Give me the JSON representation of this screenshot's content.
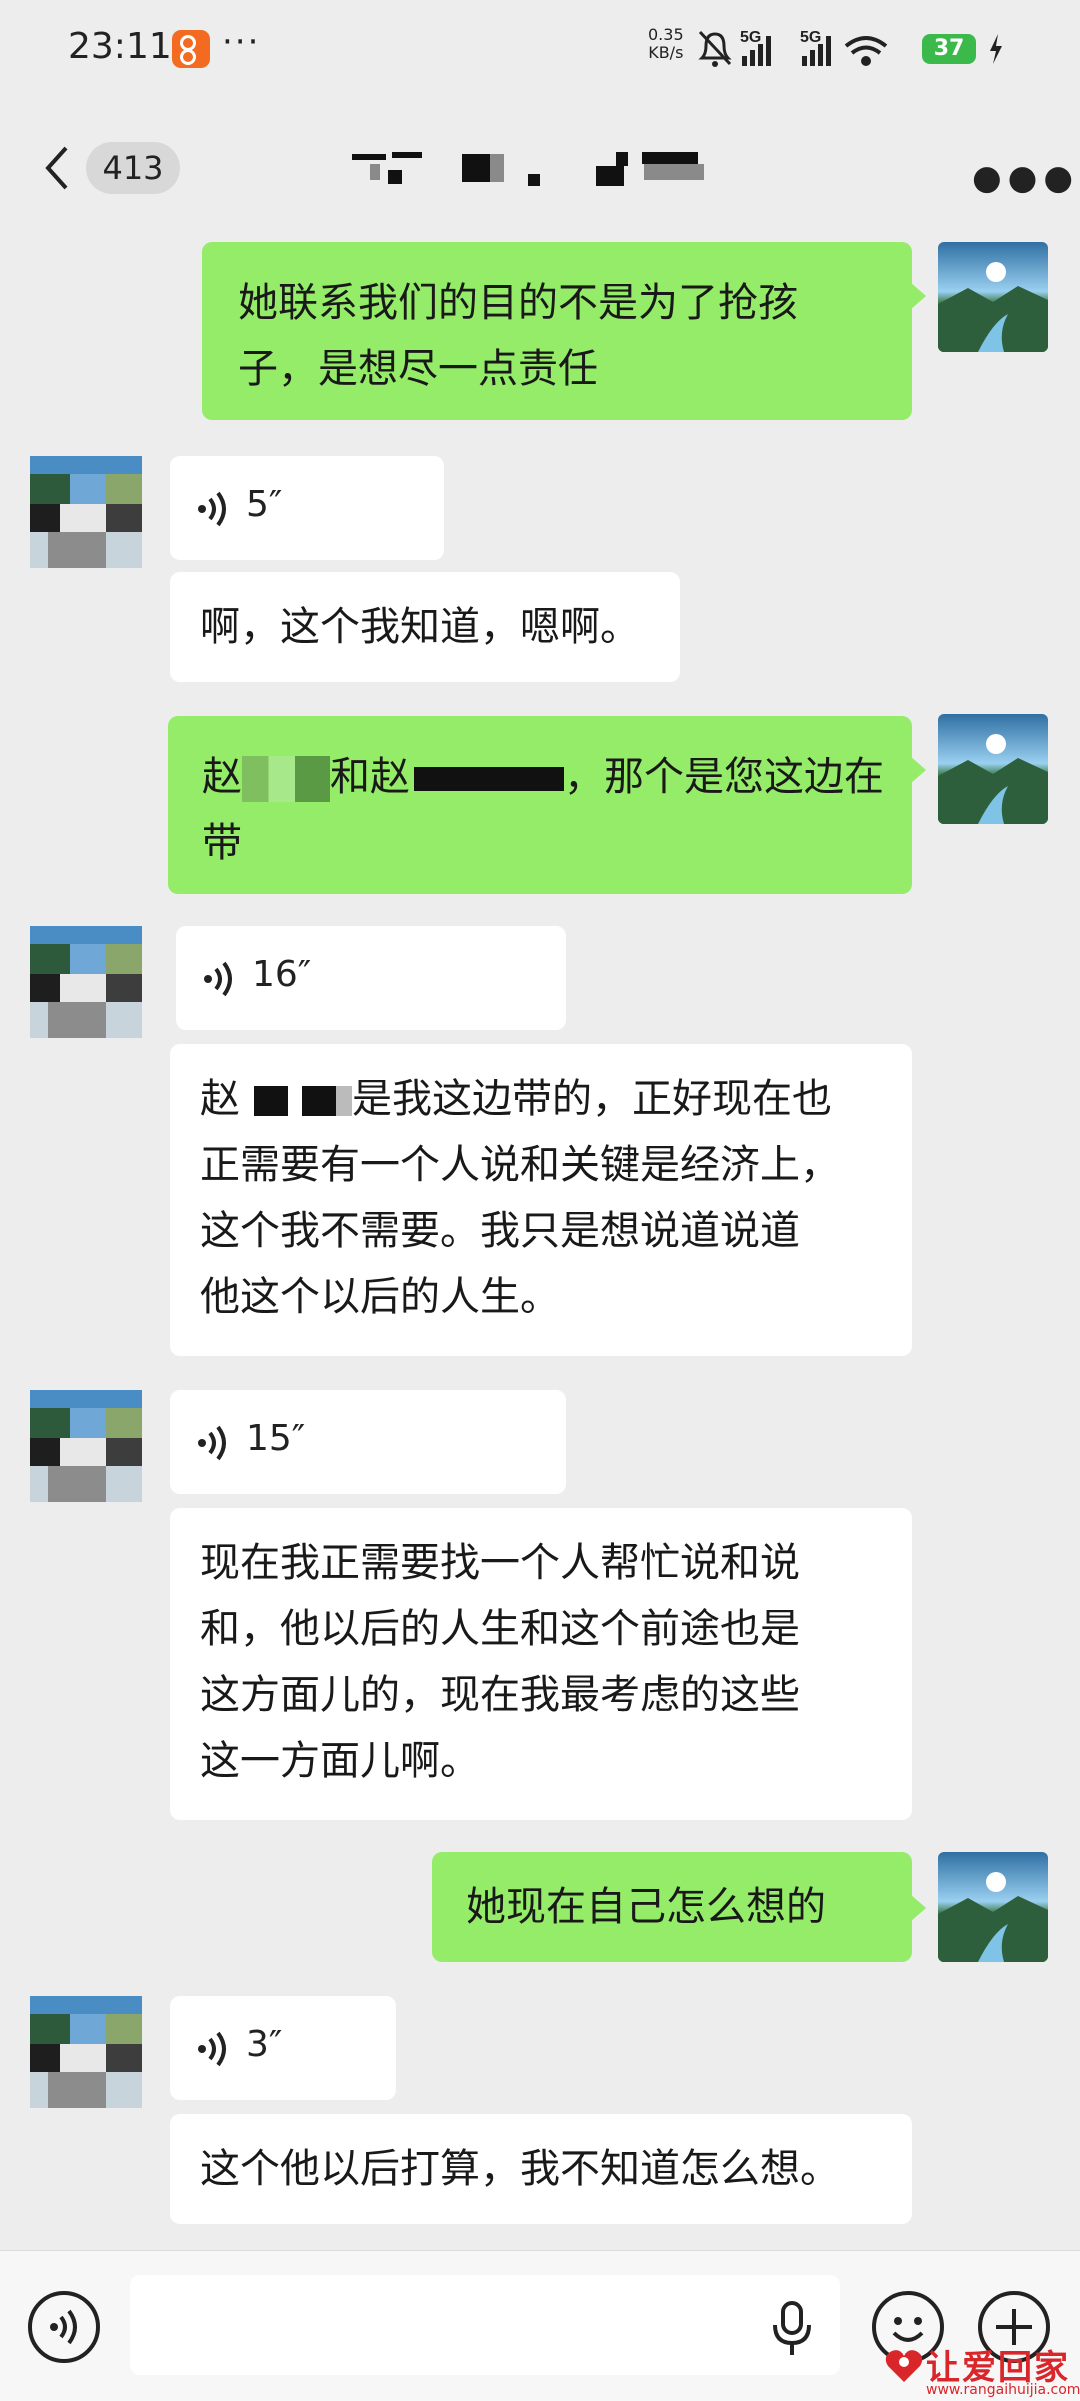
{
  "status_bar": {
    "time": "23:11",
    "dots": "···",
    "speed_value": "0.35",
    "speed_unit": "KB/s",
    "network_label_1": "5G",
    "network_label_2": "5G",
    "battery": "37"
  },
  "header": {
    "unread_count": "413",
    "title_redacted": true
  },
  "messages": [
    {
      "side": "self",
      "type": "text",
      "lines": [
        "她联系我们的目的不是为了抢孩",
        "子，是想尽一点责任"
      ]
    },
    {
      "side": "other",
      "type": "voice",
      "duration": "5″"
    },
    {
      "side": "other",
      "type": "text",
      "lines": [
        "啊，这个我知道，嗯啊。"
      ]
    },
    {
      "side": "self",
      "type": "text",
      "lines": [
        "赵",
        "和赵",
        "，那个是您这边在",
        "带"
      ]
    },
    {
      "side": "other",
      "type": "voice",
      "duration": "16″"
    },
    {
      "side": "other",
      "type": "text",
      "lines": [
        "赵",
        "是我这边带的，正好现在也",
        "正需要有一个人说和关键是经济上，",
        "这个我不需要。我只是想说道说道",
        "他这个以后的人生。"
      ]
    },
    {
      "side": "other",
      "type": "voice",
      "duration": "15″"
    },
    {
      "side": "other",
      "type": "text",
      "lines": [
        "现在我正需要找一个人帮忙说和说",
        "和，他以后的人生和这个前途也是",
        "这方面儿的，现在我最考虑的这些",
        "这一方面儿啊。"
      ]
    },
    {
      "side": "self",
      "type": "text",
      "lines": [
        "她现在自己怎么想的"
      ]
    },
    {
      "side": "other",
      "type": "voice",
      "duration": "3″"
    },
    {
      "side": "other",
      "type": "text",
      "lines": [
        "这个他以后打算，我不知道怎么想。"
      ]
    }
  ],
  "input": {
    "placeholder": ""
  },
  "watermark": {
    "text": "让爱回家",
    "url": "www.rangaihuijia.com"
  },
  "colors": {
    "self_bubble": "#95ec69",
    "other_bubble": "#ffffff",
    "background": "#ededed"
  }
}
